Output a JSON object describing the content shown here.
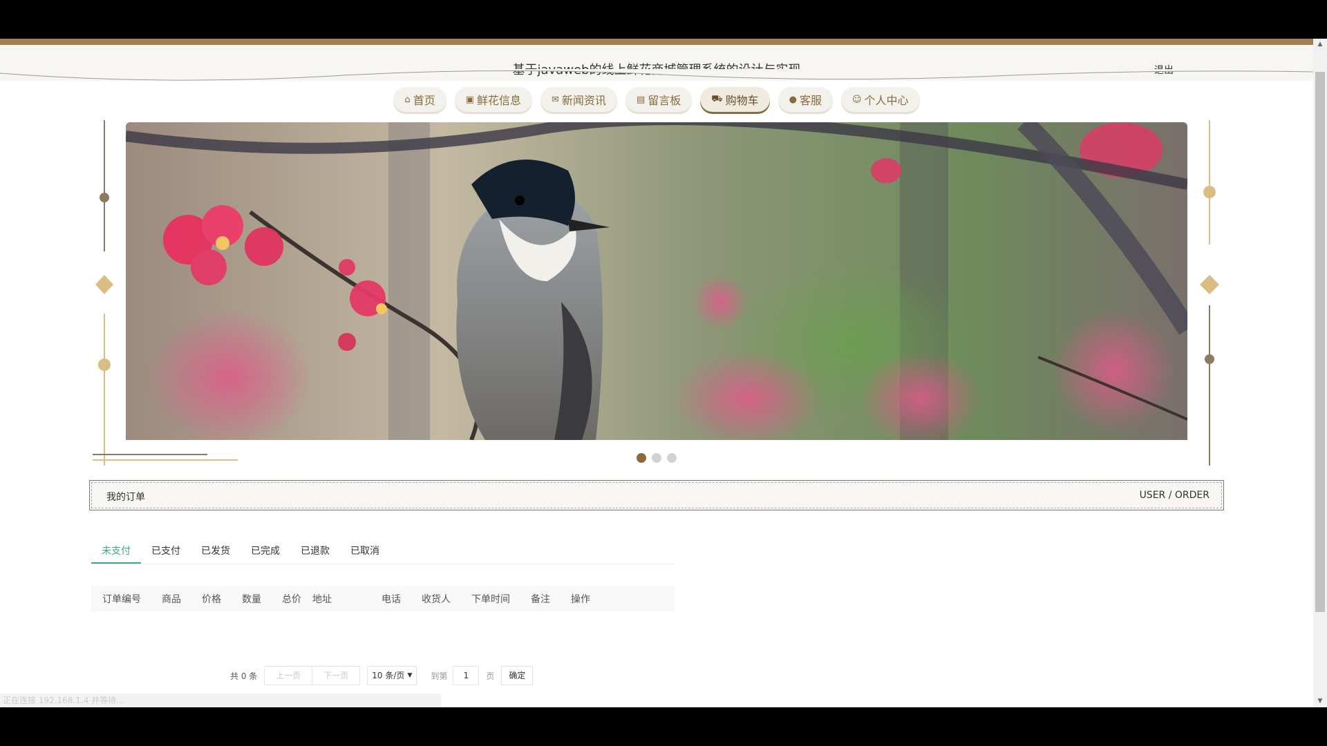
{
  "header": {
    "title": "基于javaweb的线上鲜花商城管理系统的设计与实现",
    "logout_label": "退出"
  },
  "nav": {
    "items": [
      {
        "label": "首页",
        "icon": "home-icon"
      },
      {
        "label": "鲜花信息",
        "icon": "gift-icon"
      },
      {
        "label": "新闻资讯",
        "icon": "mail-icon"
      },
      {
        "label": "留言板",
        "icon": "clipboard-icon"
      },
      {
        "label": "购物车",
        "icon": "cart-icon"
      },
      {
        "label": "客服",
        "icon": "chat-icon"
      },
      {
        "label": "个人中心",
        "icon": "user-icon"
      }
    ],
    "active_index": 4
  },
  "banner": {
    "subject": "bird-on-flowering-branch",
    "slide_count": 3,
    "active_slide": 1
  },
  "section": {
    "title": "我的订单",
    "subtitle": "USER / ORDER"
  },
  "tabs": [
    "未支付",
    "已支付",
    "已发货",
    "已完成",
    "已退款",
    "已取消"
  ],
  "active_tab": 0,
  "table": {
    "columns": [
      "订单编号",
      "商品",
      "价格",
      "数量",
      "总价",
      "地址",
      "电话",
      "收货人",
      "下单时间",
      "备注",
      "操作"
    ]
  },
  "pagination": {
    "total": "共 0 条",
    "prev": "上一页",
    "next": "下一页",
    "page_size": "10 条/页",
    "goto_label": "到第",
    "page_value": "1",
    "page_suffix": "页",
    "confirm": "确定"
  },
  "status_line": "正在连接 192.168.1.4 并等待...",
  "colors": {
    "gold": "#a27d4f",
    "brown": "#8a6a3d",
    "active_tab": "#3fa779"
  }
}
